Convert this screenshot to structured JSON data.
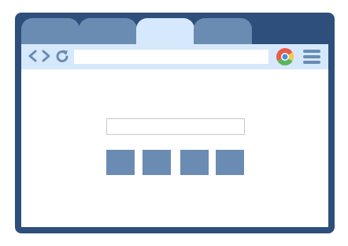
{
  "tabs": [
    {
      "label": "",
      "active": false
    },
    {
      "label": "",
      "active": false
    },
    {
      "label": "",
      "active": true
    },
    {
      "label": "",
      "active": false
    }
  ],
  "toolbar": {
    "address": {
      "value": "",
      "placeholder": ""
    },
    "icons": {
      "back": "back-arrow-icon",
      "forward": "forward-arrow-icon",
      "reload": "reload-icon",
      "browser_logo": "browser-logo-icon",
      "menu": "hamburger-menu-icon"
    }
  },
  "content": {
    "search_input": {
      "value": "",
      "placeholder": ""
    },
    "buttons": [
      {
        "label": ""
      },
      {
        "label": ""
      },
      {
        "label": ""
      },
      {
        "label": ""
      }
    ]
  },
  "colors": {
    "frame": "#2e4f7b",
    "tab_inactive": "#6a8cb2",
    "tab_active": "#d6e8fb",
    "toolbar_bg": "#d6e8fb",
    "accent": "#6a8cb2",
    "logo_colors": [
      "#e85b4a",
      "#f2c94c",
      "#57b85a",
      "#4a90d9"
    ]
  }
}
